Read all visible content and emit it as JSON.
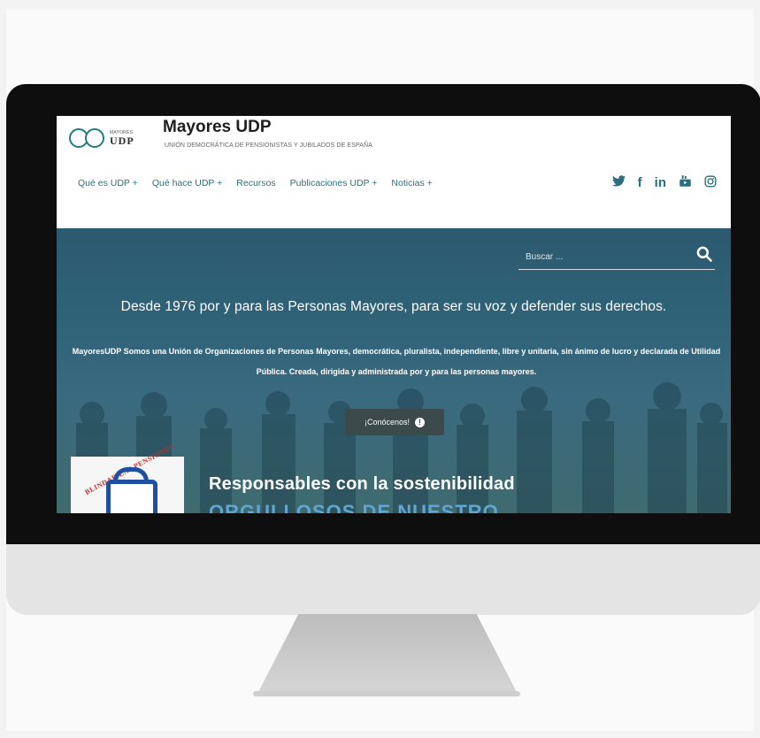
{
  "site": {
    "logo_small": "MAYORES",
    "logo_big": "UDP",
    "title": "Mayores UDP",
    "tagline": "UNIÓN DEMOCRÁTICA DE PENSIONISTAS Y JUBILADOS DE ESPAÑA"
  },
  "nav": {
    "items": [
      {
        "label": "Qué es UDP +"
      },
      {
        "label": "Qué hace UDP +"
      },
      {
        "label": "Recursos"
      },
      {
        "label": "Publicaciones UDP +"
      },
      {
        "label": "Noticias +"
      }
    ]
  },
  "social": {
    "twitter": "𝕏",
    "facebook": "f",
    "linkedin": "in",
    "youtube": "▶",
    "instagram": "◎"
  },
  "search": {
    "placeholder": "Buscar ..."
  },
  "hero": {
    "heading": "Desde 1976 por y para las Personas Mayores, para ser su voz y defender sus derechos.",
    "text": "MayoresUDP Somos una Unión de Organizaciones de Personas Mayores, democrática, pluralista, independiente, libre y unitaria, sin ánimo de lucro y declarada de Utilidad Pública. Creada, dirigida y administrada por y para las personas mayores.",
    "cta_label": "¡Conócenos!",
    "cta_icon": "!"
  },
  "promo": {
    "badge_text": "BLINDAR LAS PENSIONES",
    "title": "Responsables con la sostenibilidad",
    "subtitle": "ORGULLOSOS DE NUESTRO"
  },
  "colors": {
    "accent": "#2a6f7d",
    "hero_bg": "#2f6277",
    "cta_bg": "#3c4a4c",
    "bezel": "#0e0e0e"
  }
}
